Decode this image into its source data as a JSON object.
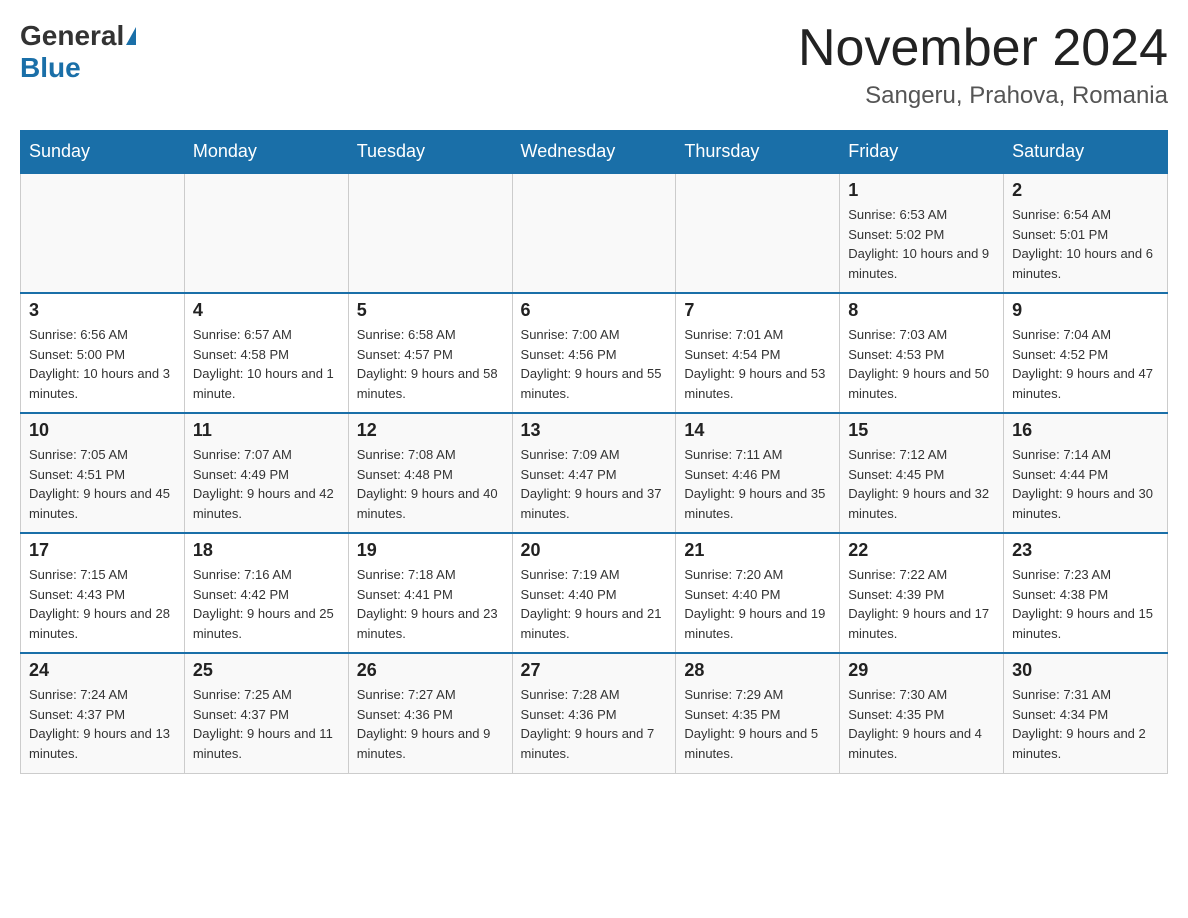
{
  "header": {
    "logo": {
      "general": "General",
      "blue": "Blue"
    },
    "title": "November 2024",
    "location": "Sangeru, Prahova, Romania"
  },
  "days_of_week": [
    "Sunday",
    "Monday",
    "Tuesday",
    "Wednesday",
    "Thursday",
    "Friday",
    "Saturday"
  ],
  "weeks": [
    [
      {
        "day": "",
        "info": ""
      },
      {
        "day": "",
        "info": ""
      },
      {
        "day": "",
        "info": ""
      },
      {
        "day": "",
        "info": ""
      },
      {
        "day": "",
        "info": ""
      },
      {
        "day": "1",
        "info": "Sunrise: 6:53 AM\nSunset: 5:02 PM\nDaylight: 10 hours and 9 minutes."
      },
      {
        "day": "2",
        "info": "Sunrise: 6:54 AM\nSunset: 5:01 PM\nDaylight: 10 hours and 6 minutes."
      }
    ],
    [
      {
        "day": "3",
        "info": "Sunrise: 6:56 AM\nSunset: 5:00 PM\nDaylight: 10 hours and 3 minutes."
      },
      {
        "day": "4",
        "info": "Sunrise: 6:57 AM\nSunset: 4:58 PM\nDaylight: 10 hours and 1 minute."
      },
      {
        "day": "5",
        "info": "Sunrise: 6:58 AM\nSunset: 4:57 PM\nDaylight: 9 hours and 58 minutes."
      },
      {
        "day": "6",
        "info": "Sunrise: 7:00 AM\nSunset: 4:56 PM\nDaylight: 9 hours and 55 minutes."
      },
      {
        "day": "7",
        "info": "Sunrise: 7:01 AM\nSunset: 4:54 PM\nDaylight: 9 hours and 53 minutes."
      },
      {
        "day": "8",
        "info": "Sunrise: 7:03 AM\nSunset: 4:53 PM\nDaylight: 9 hours and 50 minutes."
      },
      {
        "day": "9",
        "info": "Sunrise: 7:04 AM\nSunset: 4:52 PM\nDaylight: 9 hours and 47 minutes."
      }
    ],
    [
      {
        "day": "10",
        "info": "Sunrise: 7:05 AM\nSunset: 4:51 PM\nDaylight: 9 hours and 45 minutes."
      },
      {
        "day": "11",
        "info": "Sunrise: 7:07 AM\nSunset: 4:49 PM\nDaylight: 9 hours and 42 minutes."
      },
      {
        "day": "12",
        "info": "Sunrise: 7:08 AM\nSunset: 4:48 PM\nDaylight: 9 hours and 40 minutes."
      },
      {
        "day": "13",
        "info": "Sunrise: 7:09 AM\nSunset: 4:47 PM\nDaylight: 9 hours and 37 minutes."
      },
      {
        "day": "14",
        "info": "Sunrise: 7:11 AM\nSunset: 4:46 PM\nDaylight: 9 hours and 35 minutes."
      },
      {
        "day": "15",
        "info": "Sunrise: 7:12 AM\nSunset: 4:45 PM\nDaylight: 9 hours and 32 minutes."
      },
      {
        "day": "16",
        "info": "Sunrise: 7:14 AM\nSunset: 4:44 PM\nDaylight: 9 hours and 30 minutes."
      }
    ],
    [
      {
        "day": "17",
        "info": "Sunrise: 7:15 AM\nSunset: 4:43 PM\nDaylight: 9 hours and 28 minutes."
      },
      {
        "day": "18",
        "info": "Sunrise: 7:16 AM\nSunset: 4:42 PM\nDaylight: 9 hours and 25 minutes."
      },
      {
        "day": "19",
        "info": "Sunrise: 7:18 AM\nSunset: 4:41 PM\nDaylight: 9 hours and 23 minutes."
      },
      {
        "day": "20",
        "info": "Sunrise: 7:19 AM\nSunset: 4:40 PM\nDaylight: 9 hours and 21 minutes."
      },
      {
        "day": "21",
        "info": "Sunrise: 7:20 AM\nSunset: 4:40 PM\nDaylight: 9 hours and 19 minutes."
      },
      {
        "day": "22",
        "info": "Sunrise: 7:22 AM\nSunset: 4:39 PM\nDaylight: 9 hours and 17 minutes."
      },
      {
        "day": "23",
        "info": "Sunrise: 7:23 AM\nSunset: 4:38 PM\nDaylight: 9 hours and 15 minutes."
      }
    ],
    [
      {
        "day": "24",
        "info": "Sunrise: 7:24 AM\nSunset: 4:37 PM\nDaylight: 9 hours and 13 minutes."
      },
      {
        "day": "25",
        "info": "Sunrise: 7:25 AM\nSunset: 4:37 PM\nDaylight: 9 hours and 11 minutes."
      },
      {
        "day": "26",
        "info": "Sunrise: 7:27 AM\nSunset: 4:36 PM\nDaylight: 9 hours and 9 minutes."
      },
      {
        "day": "27",
        "info": "Sunrise: 7:28 AM\nSunset: 4:36 PM\nDaylight: 9 hours and 7 minutes."
      },
      {
        "day": "28",
        "info": "Sunrise: 7:29 AM\nSunset: 4:35 PM\nDaylight: 9 hours and 5 minutes."
      },
      {
        "day": "29",
        "info": "Sunrise: 7:30 AM\nSunset: 4:35 PM\nDaylight: 9 hours and 4 minutes."
      },
      {
        "day": "30",
        "info": "Sunrise: 7:31 AM\nSunset: 4:34 PM\nDaylight: 9 hours and 2 minutes."
      }
    ]
  ]
}
